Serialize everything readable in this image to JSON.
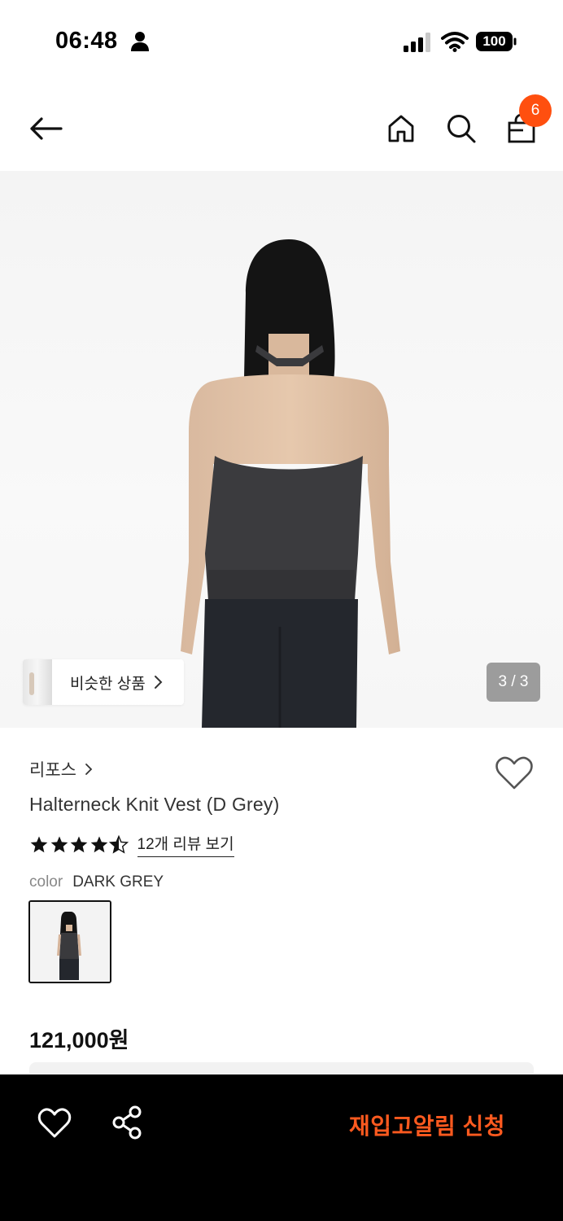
{
  "status_bar": {
    "time": "06:48",
    "battery": "100",
    "icons": [
      "person-icon",
      "signal-icon",
      "wifi-icon",
      "battery-icon"
    ]
  },
  "nav": {
    "icons": [
      "back-arrow-icon",
      "home-icon",
      "search-icon",
      "shopping-bag-icon"
    ],
    "cart_count": "6"
  },
  "hero": {
    "similar_label": "비슷한 상품",
    "counter": "3 / 3"
  },
  "product": {
    "brand": "리포스",
    "title": "Halterneck Knit Vest (D Grey)",
    "rating": 4.5,
    "review_link": "12개 리뷰 보기",
    "color_label": "color",
    "color_value": "DARK GREY",
    "price": "121,000원"
  },
  "bottom_bar": {
    "icons": [
      "heart-icon",
      "share-icon"
    ],
    "restock_label": "재입고알림 신청"
  },
  "colors": {
    "accent": "#ff4f0f",
    "bottom_bar_bg": "#000000"
  }
}
